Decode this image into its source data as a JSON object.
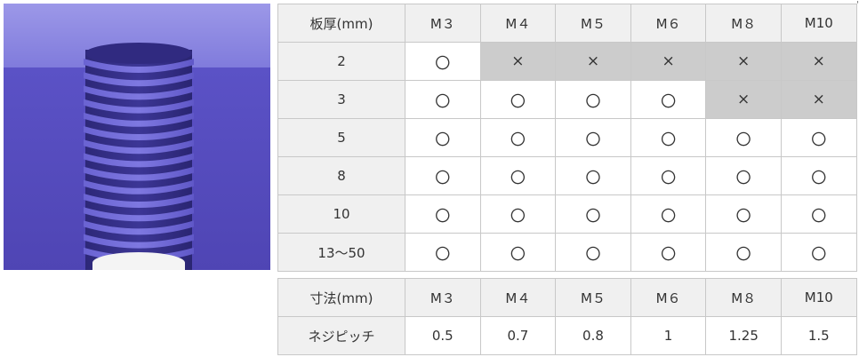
{
  "compat_table": {
    "header": [
      "板厚(mm)",
      "M３",
      "M４",
      "M５",
      "M６",
      "M８",
      "M10"
    ],
    "rows": [
      {
        "label": "2",
        "cells": [
          "〇",
          "×",
          "×",
          "×",
          "×",
          "×"
        ],
        "state": [
          "ok",
          "ng",
          "ng",
          "ng",
          "ng",
          "ng"
        ]
      },
      {
        "label": "3",
        "cells": [
          "〇",
          "〇",
          "〇",
          "〇",
          "×",
          "×"
        ],
        "state": [
          "ok",
          "ok",
          "ok",
          "ok",
          "ng",
          "ng"
        ]
      },
      {
        "label": "5",
        "cells": [
          "〇",
          "〇",
          "〇",
          "〇",
          "〇",
          "〇"
        ],
        "state": [
          "ok",
          "ok",
          "ok",
          "ok",
          "ok",
          "ok"
        ]
      },
      {
        "label": "8",
        "cells": [
          "〇",
          "〇",
          "〇",
          "〇",
          "〇",
          "〇"
        ],
        "state": [
          "ok",
          "ok",
          "ok",
          "ok",
          "ok",
          "ok"
        ]
      },
      {
        "label": "10",
        "cells": [
          "〇",
          "〇",
          "〇",
          "〇",
          "〇",
          "〇"
        ],
        "state": [
          "ok",
          "ok",
          "ok",
          "ok",
          "ok",
          "ok"
        ]
      },
      {
        "label": "13〜50",
        "cells": [
          "〇",
          "〇",
          "〇",
          "〇",
          "〇",
          "〇"
        ],
        "state": [
          "ok",
          "ok",
          "ok",
          "ok",
          "ok",
          "ok"
        ]
      }
    ]
  },
  "pitch_table": {
    "header": [
      "寸法(mm)",
      "M３",
      "M４",
      "M５",
      "M６",
      "M８",
      "M10"
    ],
    "row": {
      "label": "ネジピッチ",
      "cells": [
        "0.5",
        "0.7",
        "0.8",
        "1",
        "1.25",
        "1.5"
      ]
    }
  },
  "corner_mark": "'",
  "colors": {
    "plate_face": "#5a4fc0",
    "plate_top": "#8a86e0",
    "thread": "#3a3490",
    "unavailable_cell": "#cccccc",
    "header_cell": "#f0f0f0"
  }
}
